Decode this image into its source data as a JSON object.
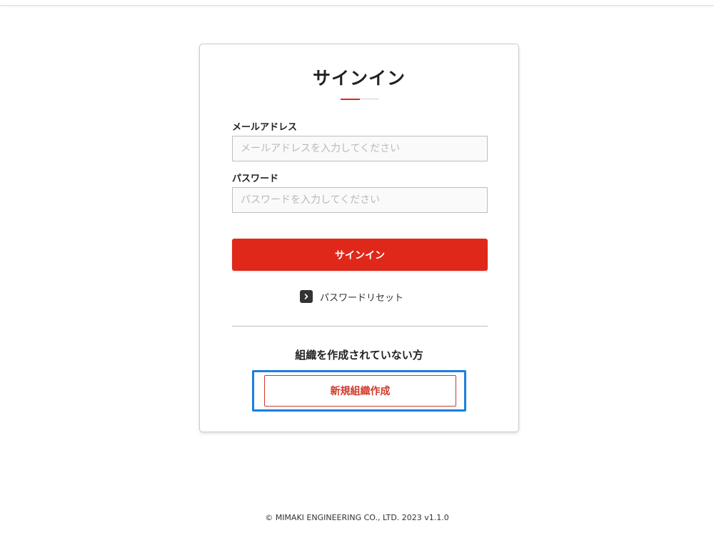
{
  "signin": {
    "title": "サインイン",
    "email_label": "メールアドレス",
    "email_placeholder": "メールアドレスを入力してください",
    "email_value": "",
    "password_label": "パスワード",
    "password_placeholder": "パスワードを入力してください",
    "password_value": "",
    "submit_label": "サインイン",
    "reset_link_label": "パスワードリセット",
    "reset_icon": "chevron-right-icon"
  },
  "create_org": {
    "heading": "組織を作成されていない方",
    "button_label": "新規組織作成"
  },
  "footer": {
    "copyright": "© MIMAKI ENGINEERING CO., LTD. 2023 v1.1.0"
  },
  "theme": {
    "accent": "#e0281a",
    "focus": "#1a7fe0"
  }
}
